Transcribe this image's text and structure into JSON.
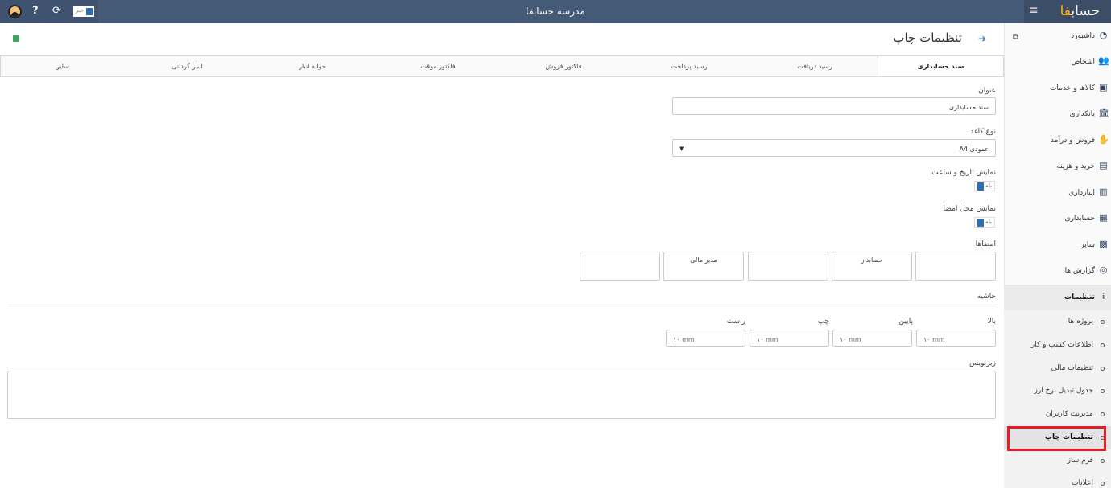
{
  "app": {
    "title": "مدرسه حسابفا",
    "brand_text": "حساب",
    "brand_accent": "فا",
    "news_label": "خبر",
    "help_glyph": "?",
    "refresh_glyph": "⟳",
    "menu_glyph": "≡"
  },
  "sidebar": {
    "toggle_glyph": "⧉",
    "items": [
      {
        "label": "داشبورد",
        "icon": "dashboard-icon",
        "glyph": "◔"
      },
      {
        "label": "اشخاص",
        "icon": "people-icon",
        "glyph": "👥"
      },
      {
        "label": "کالاها و خدمات",
        "icon": "box-icon",
        "glyph": "▣"
      },
      {
        "label": "بانکداری",
        "icon": "bank-icon",
        "glyph": "🏛"
      },
      {
        "label": "فروش و درآمد",
        "icon": "sales-icon",
        "glyph": "✋"
      },
      {
        "label": "خرید و هزینه",
        "icon": "wallet-icon",
        "glyph": "▤"
      },
      {
        "label": "انبارداری",
        "icon": "warehouse-icon",
        "glyph": "▥"
      },
      {
        "label": "حسابداری",
        "icon": "accounting-icon",
        "glyph": "▦"
      },
      {
        "label": "سایر",
        "icon": "misc-icon",
        "glyph": "▩"
      },
      {
        "label": "گزارش ها",
        "icon": "report-icon",
        "glyph": "◎"
      }
    ],
    "settings": {
      "label": "تنظیمات",
      "icon": "sliders-icon",
      "glyph": "⫶",
      "sub": [
        {
          "label": "پروژه ها"
        },
        {
          "label": "اطلاعات کسب و کار"
        },
        {
          "label": "تنظیمات مالی"
        },
        {
          "label": "جدول تبدیل نرخ ارز"
        },
        {
          "label": "مدیریت کاربران"
        },
        {
          "label": "تنظیمات چاپ",
          "active": true
        },
        {
          "label": "فرم ساز"
        },
        {
          "label": "اعلانات"
        }
      ]
    }
  },
  "page": {
    "title": "تنظیمات چاپ",
    "back_glyph": "➔",
    "tabs": [
      {
        "label": "سند حسابداری",
        "active": true
      },
      {
        "label": "رسید دریافت"
      },
      {
        "label": "رسید پرداخت"
      },
      {
        "label": "فاکتور فروش"
      },
      {
        "label": "فاکتور موقت"
      },
      {
        "label": "حواله انبار"
      },
      {
        "label": "انبار گردانی"
      },
      {
        "label": "سایر"
      }
    ]
  },
  "form": {
    "title_label": "عنوان",
    "title_value": "سند حسابداری",
    "paper_label": "نوع کاغذ",
    "paper_value": "A4 عمودی",
    "show_date_label": "نمایش تاریخ و ساعت",
    "show_date_value": "بله",
    "show_sign_label": "نمایش محل امضا",
    "show_sign_value": "بله",
    "signatures_label": "امضاها",
    "signatures": [
      "",
      "حسابدار",
      "",
      "مدیر مالی",
      ""
    ],
    "margin_label": "حاشیه",
    "margins": [
      {
        "label": "بالا",
        "value": "۱۰ mm"
      },
      {
        "label": "پایین",
        "value": "۱۰ mm"
      },
      {
        "label": "چپ",
        "value": "۱۰ mm"
      },
      {
        "label": "راست",
        "value": "۱۰ mm"
      }
    ],
    "footer_label": "زیرنویس",
    "footer_value": ""
  },
  "colors": {
    "topbar": "#455a77",
    "accent": "#2d6fb7",
    "highlight": "#e81c24",
    "brand_accent": "#ffb300"
  }
}
